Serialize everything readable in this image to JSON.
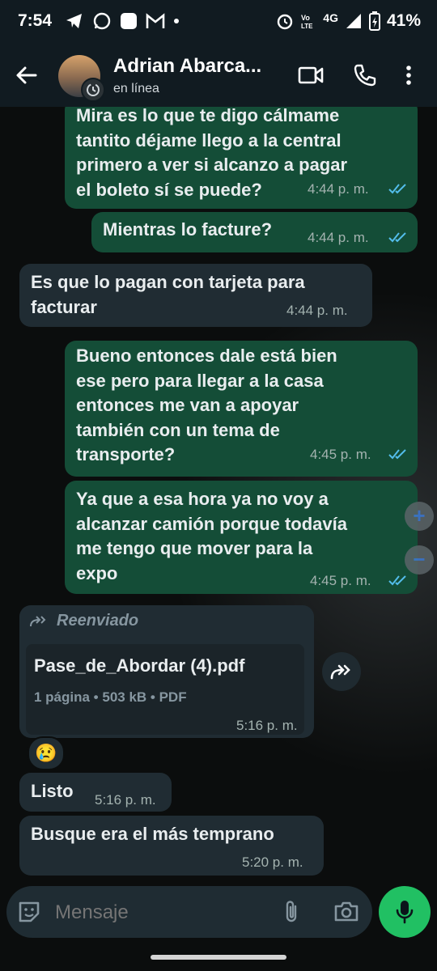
{
  "status_bar": {
    "time": "7:54",
    "battery": "41%",
    "network": "4G"
  },
  "header": {
    "contact_name": "Adrian Abarca...",
    "status": "en línea"
  },
  "messages": [
    {
      "text": "Mira es lo que te digo cálmame\ntantito déjame llego a la central\nprimero a ver si alcanzo a pagar\nel boleto sí se puede?",
      "time": "4:44 p. m."
    },
    {
      "text": "Mientras lo facture?",
      "time": "4:44 p. m."
    },
    {
      "text": "Es que lo pagan con tarjeta para\nfacturar",
      "time": "4:44 p. m."
    },
    {
      "text": "Bueno entonces dale está bien\nese pero para llegar a la casa\nentonces me van a apoyar\ntambién con un tema de\ntransporte?",
      "time": "4:45 p. m."
    },
    {
      "text": "Ya que a esa hora ya no voy a\nalcanzar camión porque todavía\nme tengo que mover para la\nexpo",
      "time": "4:45 p. m."
    }
  ],
  "forwarded": {
    "label": "Reenviado",
    "doc_name": "Pase_de_Abordar (4).pdf",
    "doc_meta": "1 página • 503 kB • PDF",
    "time": "5:16 p. m.",
    "reaction": "😢"
  },
  "incoming_more": [
    {
      "text": "Listo",
      "time": "5:16 p. m."
    },
    {
      "text": "Busque era el más temprano",
      "time": "5:20 p. m."
    }
  ],
  "composer": {
    "placeholder": "Mensaje"
  },
  "colors": {
    "outgoing_bubble": "#144d37",
    "incoming_bubble": "#202c33",
    "accent_green": "#21c063",
    "read_ticks": "#53bdeb"
  }
}
